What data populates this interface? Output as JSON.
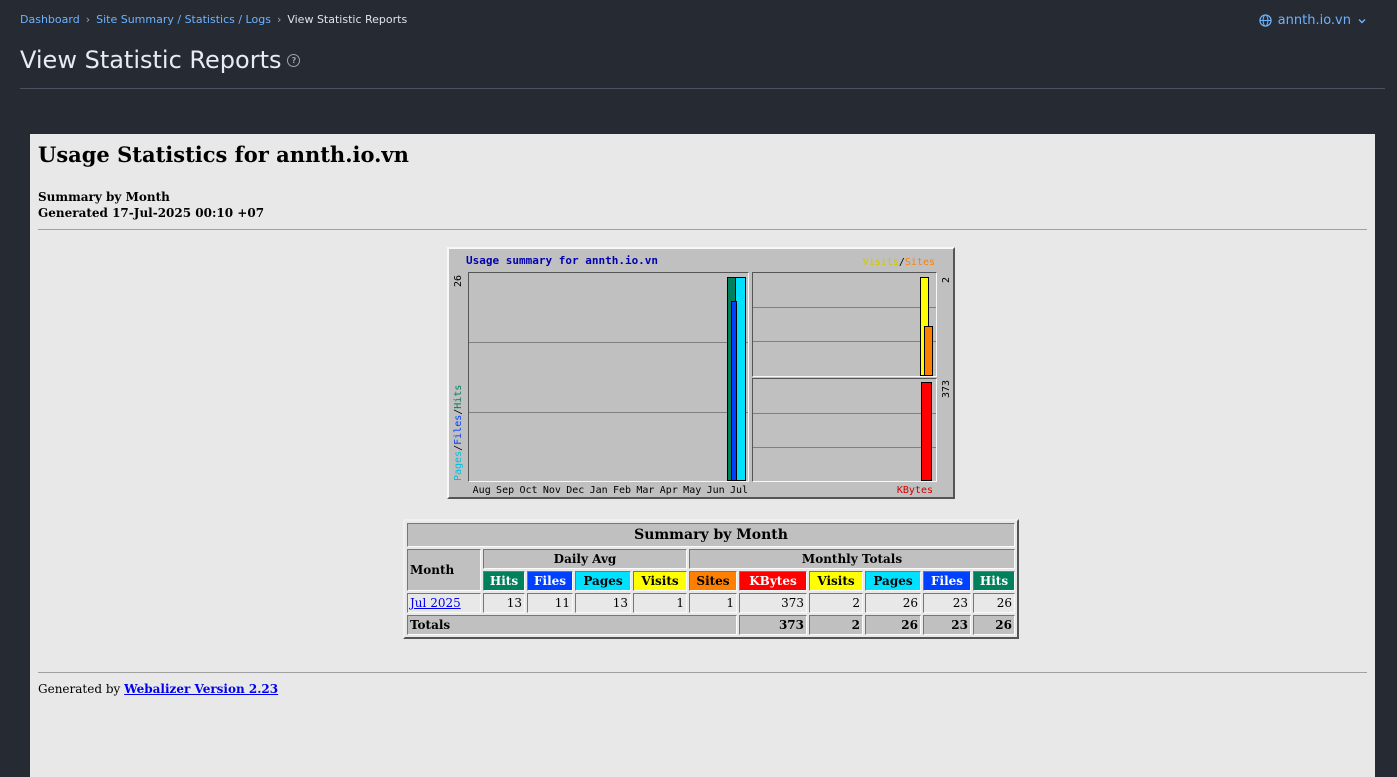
{
  "breadcrumb": {
    "dashboard": "Dashboard",
    "site_summary": "Site Summary / Statistics / Logs",
    "current": "View Statistic Reports"
  },
  "domain_switch": {
    "label": "annth.io.vn",
    "icon": "globe-icon"
  },
  "page": {
    "title": "View Statistic Reports",
    "help": "?"
  },
  "report": {
    "heading": "Usage Statistics for annth.io.vn",
    "summary_label": "Summary by Month",
    "generated": "Generated 17-Jul-2025 00:10 +07",
    "graph": {
      "title": "Usage summary for annth.io.vn",
      "visits_label": "Visits",
      "sites_label": "Sites",
      "y_hits_max": "26",
      "y_visits_max": "2",
      "y_kbytes_max": "373",
      "left_axis_pages": "Pages",
      "left_axis_files": "Files",
      "left_axis_hits": "Hits",
      "kbytes_label": "KBytes",
      "months": [
        "Aug",
        "Sep",
        "Oct",
        "Nov",
        "Dec",
        "Jan",
        "Feb",
        "Mar",
        "Apr",
        "May",
        "Jun",
        "Jul"
      ]
    },
    "table": {
      "title": "Summary by Month",
      "month_header": "Month",
      "daily_avg": "Daily Avg",
      "monthly_totals": "Monthly Totals",
      "cols": {
        "hits": "Hits",
        "files": "Files",
        "pages": "Pages",
        "visits": "Visits",
        "sites": "Sites",
        "kbytes": "KBytes"
      },
      "row": {
        "month": "Jul 2025",
        "avg_hits": "13",
        "avg_files": "11",
        "avg_pages": "13",
        "avg_visits": "1",
        "sites": "1",
        "kbytes": "373",
        "visits": "2",
        "pages": "26",
        "files": "23",
        "hits": "26"
      },
      "totals": {
        "label": "Totals",
        "kbytes": "373",
        "visits": "2",
        "pages": "26",
        "files": "23",
        "hits": "26"
      }
    },
    "footer": {
      "prefix": "Generated by",
      "link": "Webalizer Version 2.23"
    }
  },
  "chart_data": {
    "type": "bar",
    "categories": [
      "Aug",
      "Sep",
      "Oct",
      "Nov",
      "Dec",
      "Jan",
      "Feb",
      "Mar",
      "Apr",
      "May",
      "Jun",
      "Jul"
    ],
    "series": [
      {
        "name": "Hits",
        "values": [
          0,
          0,
          0,
          0,
          0,
          0,
          0,
          0,
          0,
          0,
          0,
          26
        ]
      },
      {
        "name": "Files",
        "values": [
          0,
          0,
          0,
          0,
          0,
          0,
          0,
          0,
          0,
          0,
          0,
          23
        ]
      },
      {
        "name": "Pages",
        "values": [
          0,
          0,
          0,
          0,
          0,
          0,
          0,
          0,
          0,
          0,
          0,
          26
        ]
      },
      {
        "name": "Visits",
        "values": [
          0,
          0,
          0,
          0,
          0,
          0,
          0,
          0,
          0,
          0,
          0,
          2
        ]
      },
      {
        "name": "Sites",
        "values": [
          0,
          0,
          0,
          0,
          0,
          0,
          0,
          0,
          0,
          0,
          0,
          1
        ]
      },
      {
        "name": "KBytes",
        "values": [
          0,
          0,
          0,
          0,
          0,
          0,
          0,
          0,
          0,
          0,
          0,
          373
        ]
      }
    ],
    "colors": {
      "hits": "#00805c",
      "files": "#0040ff",
      "pages": "#00e0ff",
      "visits": "#ffff00",
      "sites": "#ff8000",
      "kbytes": "#ff0000"
    }
  }
}
